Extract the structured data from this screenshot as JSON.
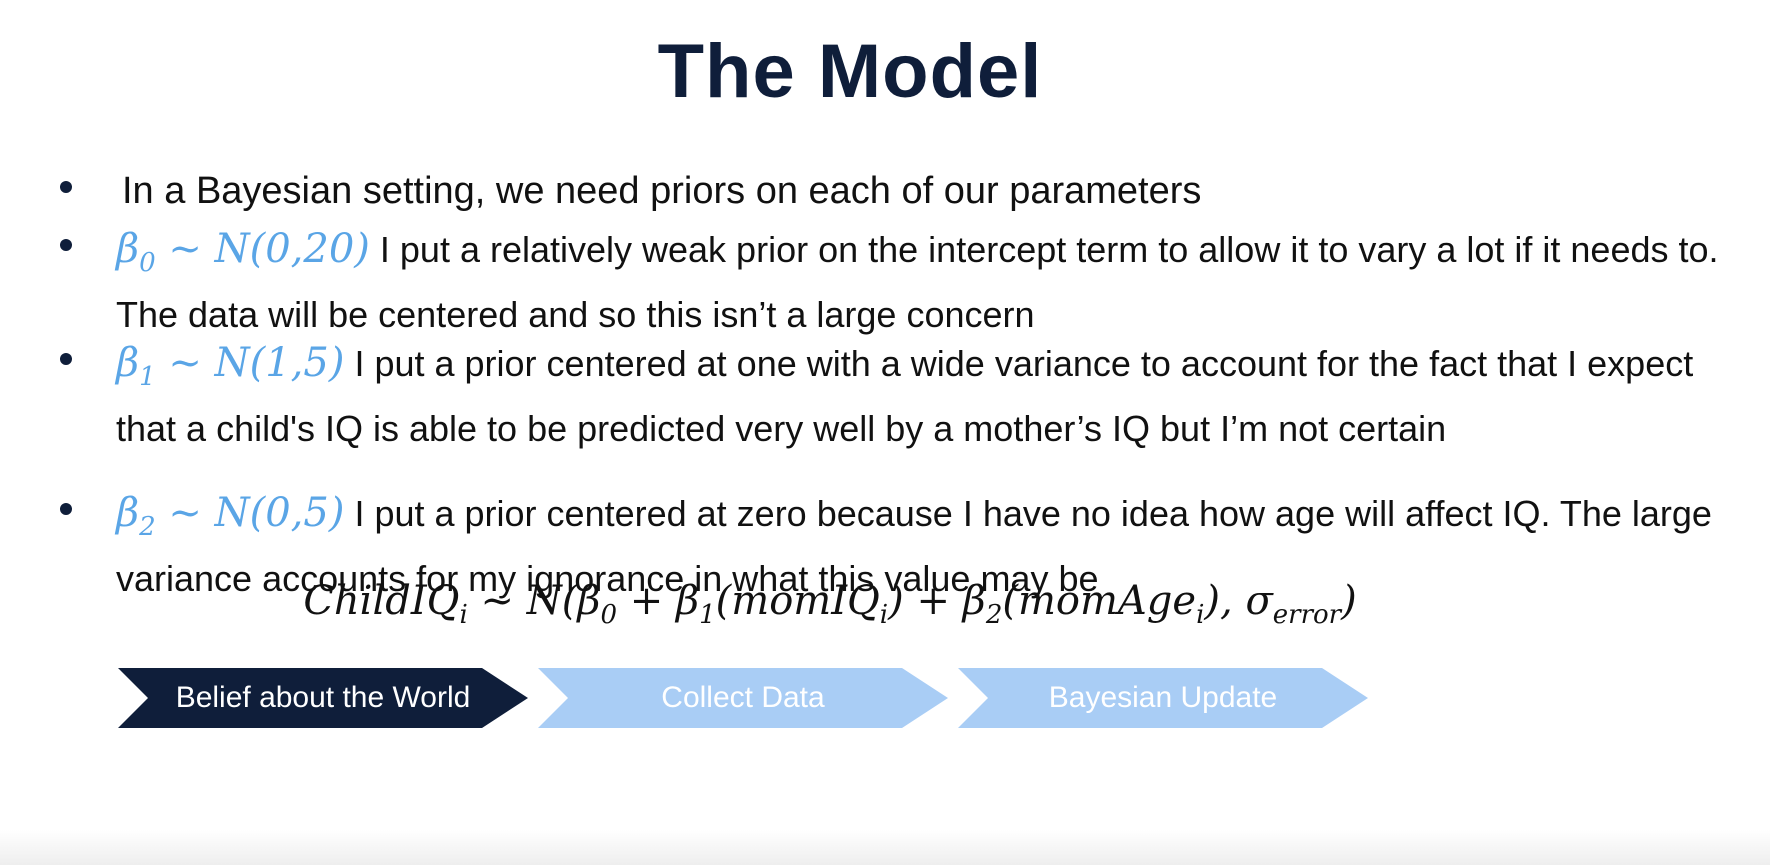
{
  "slide": {
    "title": "The Model",
    "bullets": [
      {
        "text": "In a Bayesian setting, we need priors on each of our parameters"
      },
      {
        "math_symbol": "β",
        "math_sub": "0",
        "math_dist": " ~ N(0,20)",
        "text": "I put a relatively weak prior on the intercept term to allow it to vary a lot if it needs to. The data will be centered and so this isn’t a large concern"
      },
      {
        "math_symbol": "β",
        "math_sub": "1",
        "math_dist": " ~ N(1,5)",
        "text": "I put a prior centered at one with a wide variance to account for the fact that I expect that a child's IQ is able to be predicted very well by a mother’s IQ but I’m not certain"
      },
      {
        "math_symbol": "β",
        "math_sub": "2",
        "math_dist": " ~ N(0,5)",
        "text": "I put a prior centered at zero because I have no idea how age will affect IQ. The large variance accounts for my ignorance in what this value may be"
      }
    ],
    "formula": {
      "lhs": "ChildIQ",
      "lhs_sub": "i",
      "part1": " ~ N(β",
      "part1_sub": "0",
      "part2": " +  β",
      "part2_sub": "1",
      "part3": "(momIQ",
      "part3_sub": "i",
      "part4": ") + β",
      "part4_sub": "2",
      "part5": "(momAge",
      "part5_sub": "i",
      "part6": "), σ",
      "part6_sub": "error",
      "part7": ")"
    },
    "process_steps": [
      {
        "label": "Belief about the World",
        "color": "#0f1e3a"
      },
      {
        "label": "Collect Data",
        "color": "#a9cdf5"
      },
      {
        "label": "Bayesian Update",
        "color": "#a9cdf5"
      }
    ],
    "accent_color": "#5aa5e6"
  }
}
